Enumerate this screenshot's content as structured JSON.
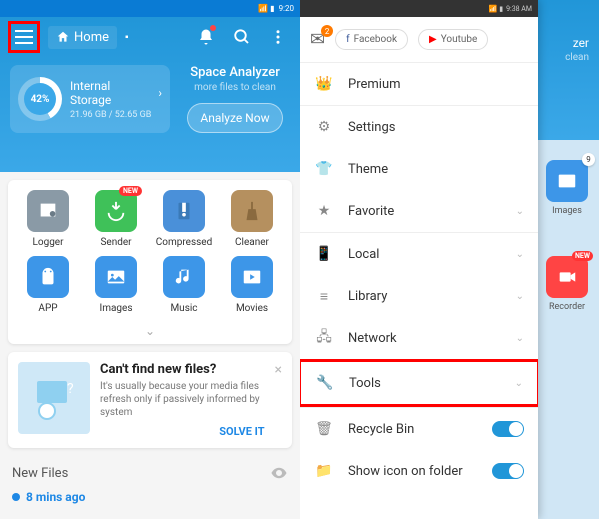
{
  "statusbar_right": "9:20",
  "header": {
    "home_label": "Home",
    "analyzer_title": "Space Analyzer",
    "analyzer_sub": "more files to clean",
    "analyze_btn": "Analyze Now"
  },
  "storage": {
    "percent": "42%",
    "title": "Internal Storage",
    "sub": "21.96 GB / 52.65 GB"
  },
  "categories": {
    "row1": [
      "Logger",
      "Sender",
      "Compressed",
      "Cleaner"
    ],
    "row2": [
      "APP",
      "Images",
      "Music",
      "Movies"
    ],
    "new_badge": "NEW"
  },
  "info_card": {
    "title": "Can't find new files?",
    "desc": "It's usually because your media files refresh only if passively informed by system",
    "solve": "SOLVE IT"
  },
  "newfiles": {
    "title": "New Files",
    "time": "8 mins ago"
  },
  "right_peek": {
    "zer_text": "zer",
    "clean_text": "clean",
    "images_label": "Images",
    "images_count": "9",
    "recorder_label": "Recorder",
    "recorder_badge": "NEW"
  },
  "drawer": {
    "status_time": "9:38 AM",
    "mail_count": "2",
    "facebook": "Facebook",
    "youtube": "Youtube",
    "items": [
      {
        "label": "Premium"
      },
      {
        "label": "Settings"
      },
      {
        "label": "Theme"
      },
      {
        "label": "Favorite"
      },
      {
        "label": "Local"
      },
      {
        "label": "Library"
      },
      {
        "label": "Network"
      },
      {
        "label": "Tools"
      },
      {
        "label": "Recycle Bin"
      },
      {
        "label": "Show icon on folder"
      }
    ]
  }
}
